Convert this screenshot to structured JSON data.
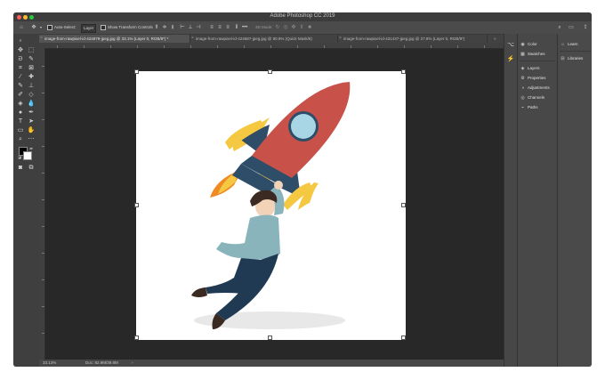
{
  "window": {
    "title": "Adobe Photoshop CC 2019"
  },
  "traffic_lights": {
    "close": "#fe5f57",
    "minimize": "#febc2e",
    "zoom": "#28c840"
  },
  "options_bar": {
    "auto_select_label": "Auto-Select:",
    "auto_select_target": "Layer",
    "show_transform_label": "Show Transform Controls",
    "mode_3d_label": "3D Mode:"
  },
  "tabs": [
    {
      "label": "image-from-rawpixel-id-424879-jpeg.jpg @ 33.1% (Layer 0, RGB/8*) *"
    },
    {
      "label": "image-from-rawpixel-id-424687-jpeg.jpg @ 80.9% (Quick Mask/8)"
    },
    {
      "label": "image-from-rawpixel-id-431437-jpeg.jpg @ 27.8% (Layer 0, RGB/8*)"
    }
  ],
  "status": {
    "zoom": "33.13%",
    "doc": "Doc: 82.9M/39.8M"
  },
  "panels": {
    "color": "Color",
    "swatches": "Swatches",
    "layers": "Layers",
    "properties": "Properties",
    "adjustments": "Adjustments",
    "channels": "Channels",
    "paths": "Paths",
    "learn": "Learn",
    "libraries": "Libraries"
  },
  "colors": {
    "rocket_body": "#c8524a",
    "rocket_window": "#a9d6e5",
    "fins": "#2e4d68",
    "flame_yellow": "#f5c842",
    "flame_orange": "#f08a24",
    "shirt": "#8ab4bc",
    "pants": "#1f3a52",
    "hair": "#3a2a22",
    "skin": "#f3d3b8"
  }
}
